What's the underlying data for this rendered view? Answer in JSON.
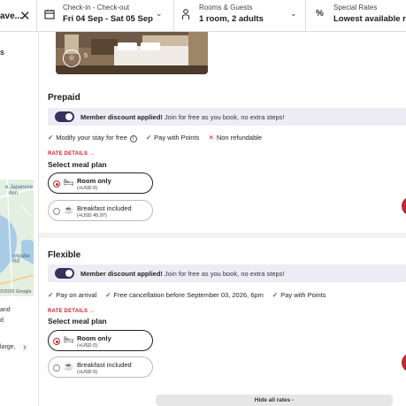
{
  "topbar": {
    "destination": "ave...",
    "dates": {
      "label": "Check-in - Check-out",
      "value": "Fri 04 Sep - Sat 05 Sep"
    },
    "guests": {
      "label": "Rooms & Guests",
      "value": "1 room, 2 adults"
    },
    "rates": {
      "label": "Special Rates",
      "value": "Lowest available rat"
    }
  },
  "sidebar": {
    "dots": "s",
    "map_labels": [
      "e Japanese",
      "den",
      "onyabe Rd"
    ],
    "map_credit": "©2026 Google",
    "text_and": "and",
    "text_d": "d",
    "text_large": "large,"
  },
  "main": {
    "photo_count": "5",
    "rate_link": "RATE DETAILS",
    "meal_title": "Select meal plan",
    "hide_rates": "Hide all rates -",
    "prepaid": {
      "title": "Prepaid",
      "discount_bold": "Member discount applied!",
      "discount_text": " Join for free as you book, no extra steps!",
      "features": [
        "Modify your stay for free",
        "Pay with Points",
        "Non refundable"
      ],
      "options": [
        {
          "name": "Room only",
          "price": "(+USD 0)"
        },
        {
          "name": "Breakfast included",
          "price": "(+USD 45.97)"
        }
      ]
    },
    "flexible": {
      "title": "Flexible",
      "discount_bold": "Member discount applied!",
      "discount_text": " Join for free as you book, no extra steps!",
      "features": [
        "Pay on arrival",
        "Free cancellation before September 03, 2026, 6pm",
        "Pay with Points"
      ],
      "options": [
        {
          "name": "Room only",
          "price": "(+USD 0)"
        },
        {
          "name": "Breakfast included",
          "price": "(+USD 0)"
        }
      ]
    }
  },
  "colors": {
    "accent": "#c5272d",
    "toggle": "#3a2e5c",
    "banner": "#edecf5"
  }
}
